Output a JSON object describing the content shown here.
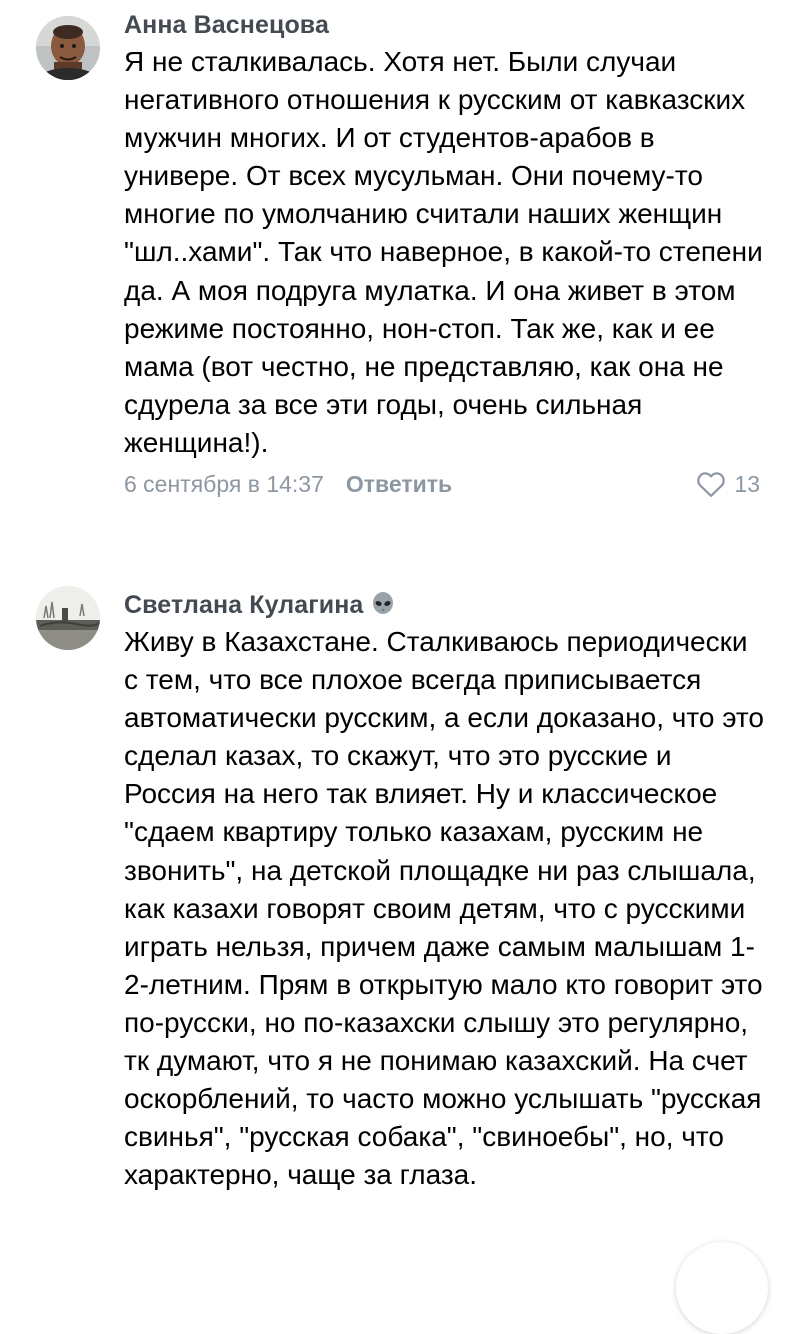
{
  "colors": {
    "author": "#444a52",
    "meta": "#8d97a3",
    "text": "#000000"
  },
  "comments": [
    {
      "author": "Анна Васнецова",
      "text": "Я не сталкивалась. Хотя нет. Были случаи негативного отношения к русским от кавказских мужчин многих. И от студентов-арабов в универе. От всех мусульман. Они почему-то многие по умолчанию считали наших женщин \"шл..хами\". Так что наверное, в какой-то степени да. А моя подруга мулатка. И она живет в этом режиме постоянно, нон-стоп. Так же, как и ее мама (вот честно, не представляю, как она не сдурела за все эти годы, очень сильная женщина!).",
      "date": "6 сентября в 14:37",
      "reply_label": "Ответить",
      "likes": "13"
    },
    {
      "author": "Светлана Кулагина",
      "author_badge_icon": "alien-icon",
      "text": "Живу в Казахстане. Сталкиваюсь периодически с тем, что все плохое всегда приписывается автоматически русским, а если доказано, что это сделал казах, то скажут, что это русские и Россия на него так влияет. Ну и классическое \"сдаем квартиру только казахам, русским не звонить\", на детской площадке ни раз  слышала, как казахи говорят своим детям, что с русскими играть нельзя, причем даже самым малышам 1-2-летним. Прям в открытую мало кто говорит это по-русски, но по-казахски слышу это регулярно, тк думают, что я не понимаю казахский. На счет оскорблений, то часто можно услышать \"русская свинья\", \"русская собака\", \"свиноебы\", но, что характерно, чаще за глаза."
    }
  ]
}
